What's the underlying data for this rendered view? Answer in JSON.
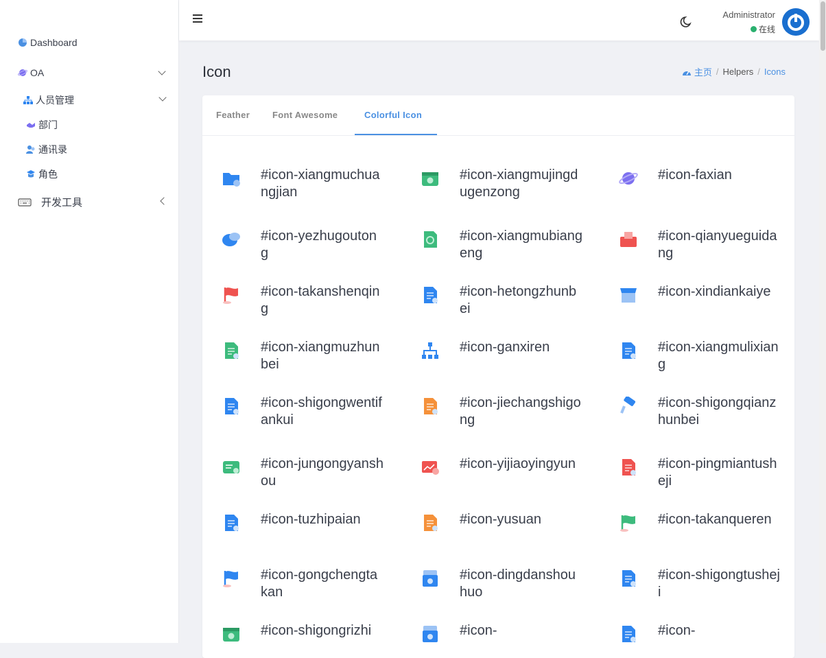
{
  "sidebar": {
    "items": [
      {
        "label": "Dashboard",
        "icon": "dashboard-icon"
      },
      {
        "label": "OA",
        "icon": "planet-icon"
      },
      {
        "label": "人员管理",
        "icon": "org-icon"
      },
      {
        "label": "部门",
        "icon": "handshake-icon"
      },
      {
        "label": "通讯录",
        "icon": "contacts-icon"
      },
      {
        "label": "角色",
        "icon": "role-icon"
      },
      {
        "label": "开发工具",
        "icon": "keyboard-icon"
      }
    ]
  },
  "header": {
    "username": "Administrator",
    "status": "在线",
    "status_color": "#2ab06f"
  },
  "page": {
    "title": "Icon",
    "breadcrumb": {
      "home": "主页",
      "section": "Helpers",
      "current": "Icons"
    }
  },
  "tabs": [
    "Feather",
    "Font Awesome",
    "Colorful Icon"
  ],
  "active_tab": "Colorful Icon",
  "icons": [
    {
      "name": "#icon-xiangmuchuangjian",
      "color": "#2f86f0"
    },
    {
      "name": "#icon-xiangmujingdugenzong",
      "color": "#3dbb7d"
    },
    {
      "name": "#icon-faxian",
      "color": "#7c6ff0"
    },
    {
      "name": "#icon-yezhugoutong",
      "color": "#2f86f0"
    },
    {
      "name": "#icon-xiangmubiangeng",
      "color": "#3dbb7d"
    },
    {
      "name": "#icon-qianyueguidang",
      "color": "#ef5350"
    },
    {
      "name": "#icon-takanshenqing",
      "color": "#ef5350"
    },
    {
      "name": "#icon-hetongzhunbei",
      "color": "#2f86f0"
    },
    {
      "name": "#icon-xindiankaiye",
      "color": "#2f86f0"
    },
    {
      "name": "#icon-xiangmuzhunbei",
      "color": "#3dbb7d"
    },
    {
      "name": "#icon-ganxiren",
      "color": "#2f86f0"
    },
    {
      "name": "#icon-xiangmulixiang",
      "color": "#2f86f0"
    },
    {
      "name": "#icon-shigongwentifankui",
      "color": "#2f86f0"
    },
    {
      "name": "#icon-jiechangshigong",
      "color": "#f5913a"
    },
    {
      "name": "#icon-shigongqianzhunbei",
      "color": "#2f86f0"
    },
    {
      "name": "#icon-jungongyanshou",
      "color": "#3dbb7d"
    },
    {
      "name": "#icon-yijiaoyingyun",
      "color": "#ef5350"
    },
    {
      "name": "#icon-pingmiantusheji",
      "color": "#ef5350"
    },
    {
      "name": "#icon-tuzhipaian",
      "color": "#2f86f0"
    },
    {
      "name": "#icon-yusuan",
      "color": "#f5913a"
    },
    {
      "name": "#icon-takanqueren",
      "color": "#3dbb7d"
    },
    {
      "name": "#icon-gongchengtakan",
      "color": "#2f86f0"
    },
    {
      "name": "#icon-dingdanshouhuo",
      "color": "#2f86f0"
    },
    {
      "name": "#icon-shigongtusheji",
      "color": "#2f86f0"
    },
    {
      "name": "#icon-shigongrizhi",
      "color": "#3dbb7d"
    },
    {
      "name": "#icon-",
      "color": "#2f86f0"
    },
    {
      "name": "#icon-",
      "color": "#2f86f0"
    }
  ]
}
